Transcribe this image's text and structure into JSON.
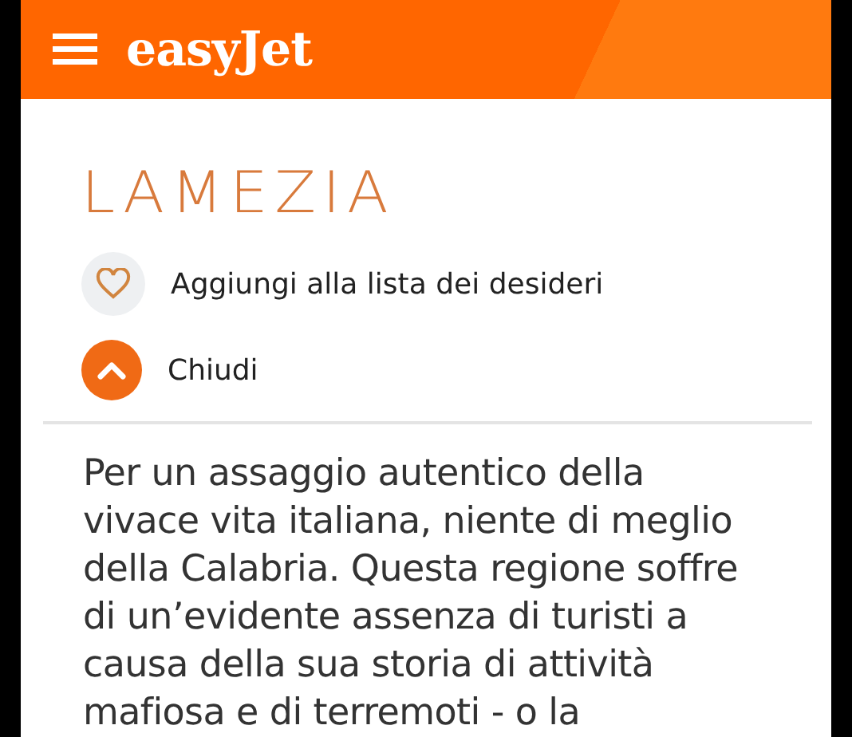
{
  "header": {
    "logo": "easyJet"
  },
  "destination": {
    "title": "LAMEZIA"
  },
  "wishlist": {
    "label": "Aggiungi alla lista dei desideri"
  },
  "toggle": {
    "label": "Chiudi",
    "expanded": true
  },
  "description": {
    "lines": [
      "Per un assaggio autentico della",
      "vivace vita italiana, niente di meglio",
      "della Calabria. Questa regione soffre",
      "di un’evidente assenza di turisti a",
      "causa della sua storia di attività",
      "mafiosa e di terremoti - o la"
    ]
  }
}
